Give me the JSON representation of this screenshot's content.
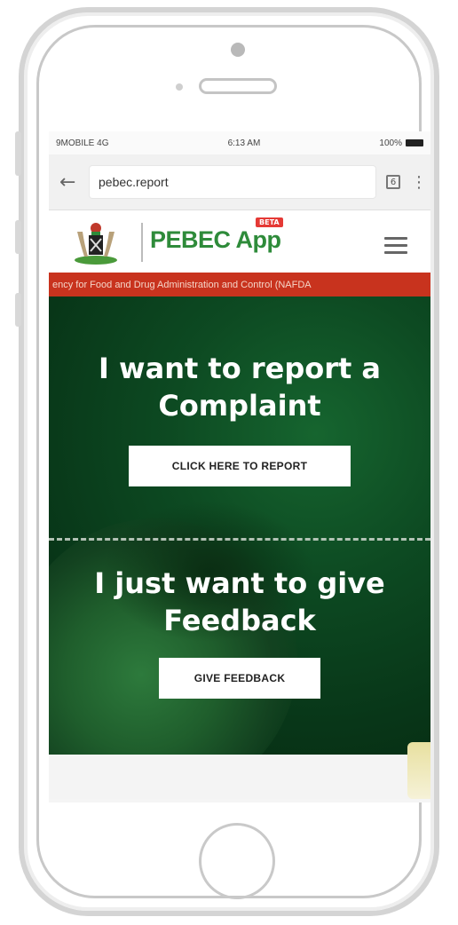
{
  "status_bar": {
    "carrier": "9MOBILE 4G",
    "time": "6:13 AM",
    "battery": "100%"
  },
  "browser": {
    "url": "pebec.report",
    "tab_count": "6"
  },
  "site": {
    "brand": "PEBEC App",
    "beta_badge": "BETA",
    "ticker_text": "ency for Food and Drug Administration and Control (NAFDA"
  },
  "hero": {
    "complaint_heading_line1": "I want to report a",
    "complaint_heading_line2": "Complaint",
    "report_button": "CLICK HERE TO REPORT",
    "feedback_heading_line1": "I just want to give",
    "feedback_heading_line2": "Feedback",
    "feedback_button": "GIVE FEEDBACK"
  },
  "colors": {
    "brand_green": "#2e8b3a",
    "ticker_red": "#c8331e",
    "hero_green": "#0d4a22"
  }
}
